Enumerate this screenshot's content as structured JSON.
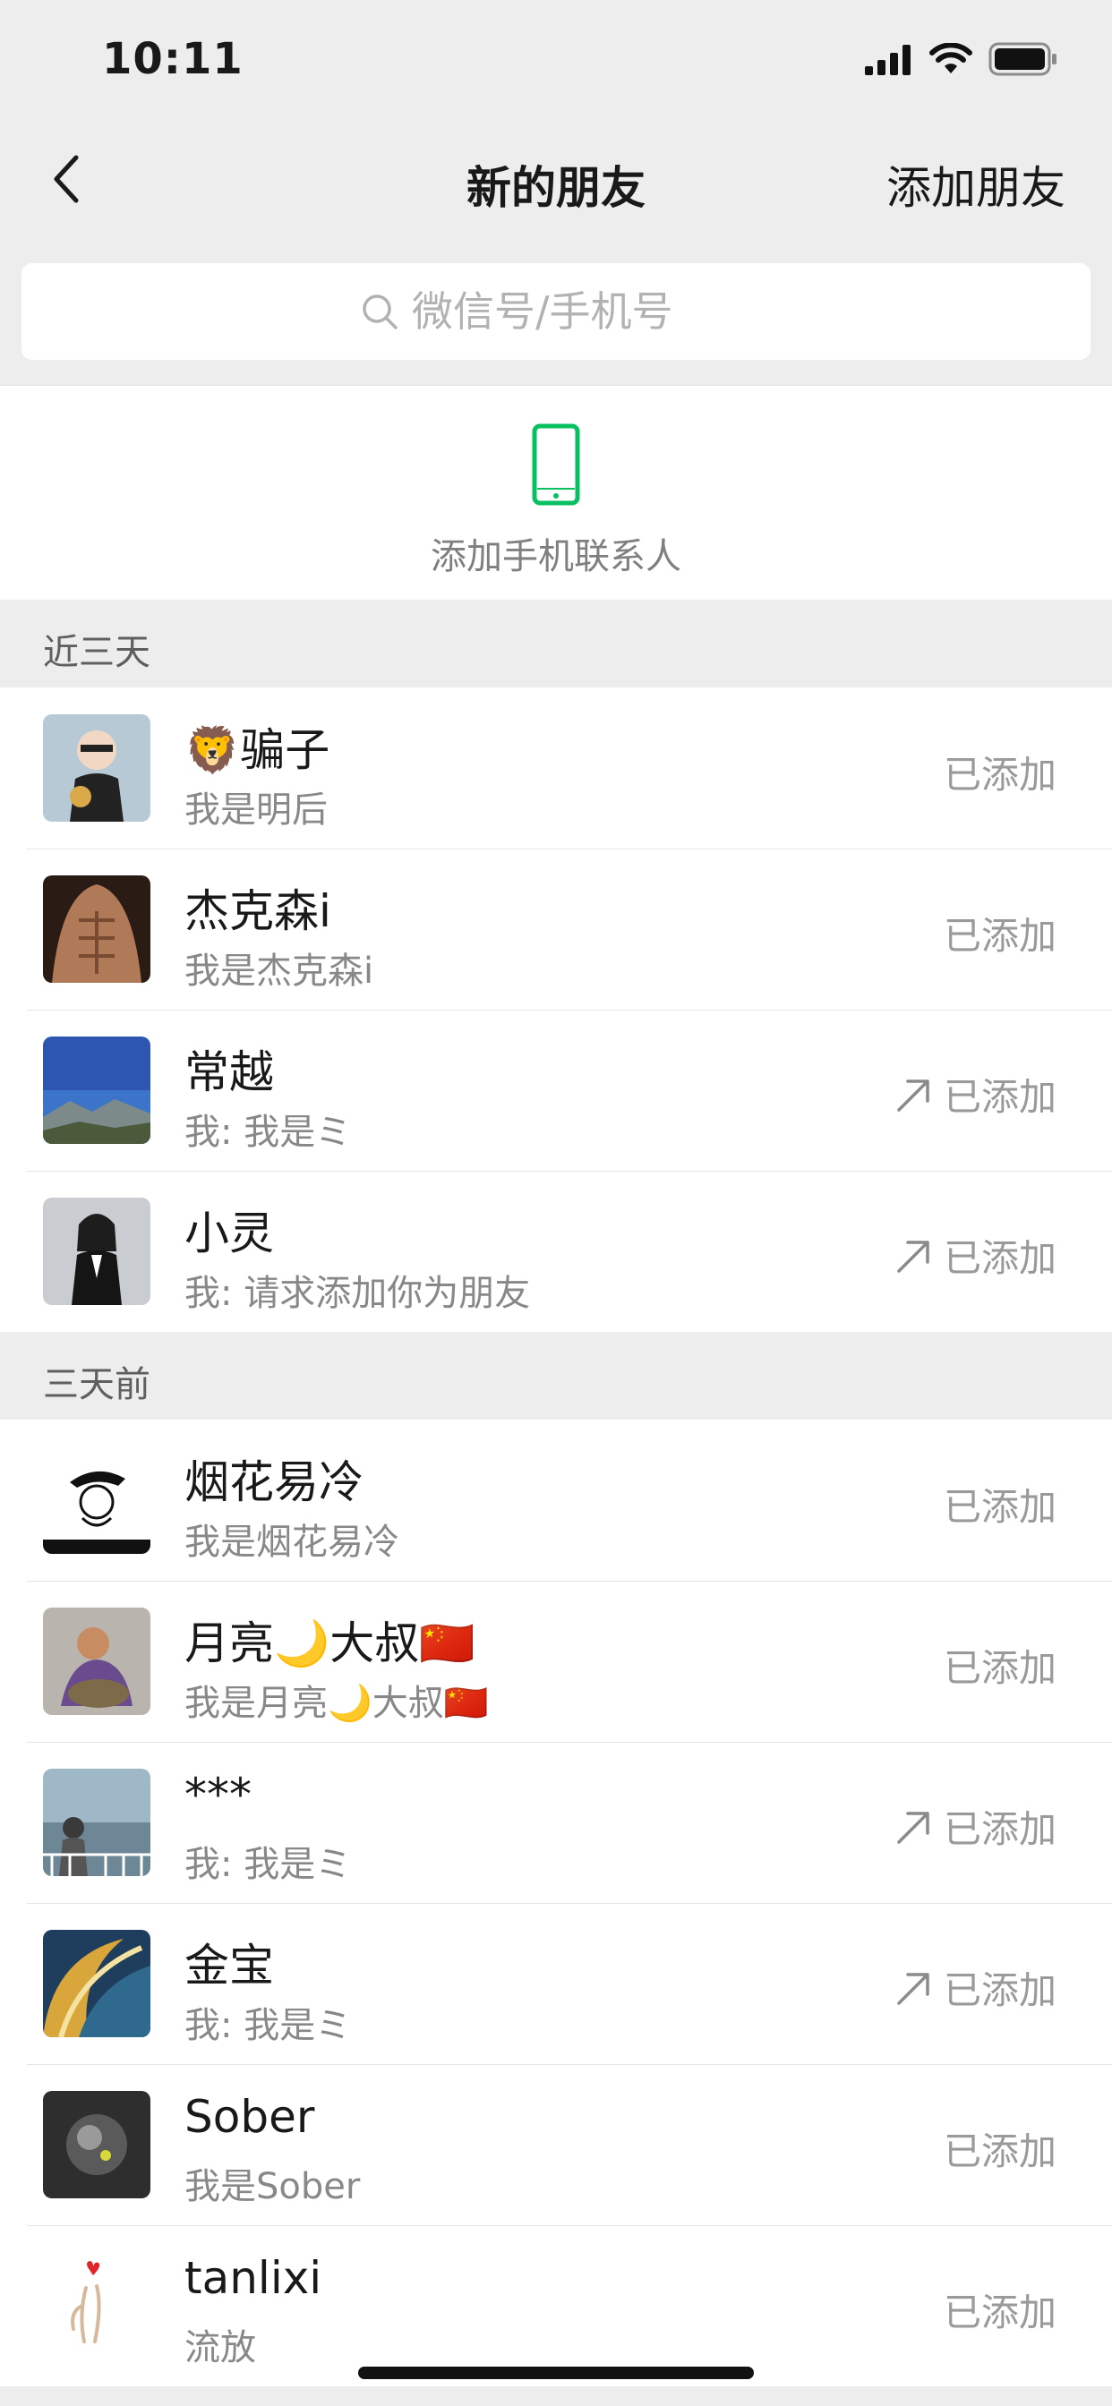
{
  "status_bar": {
    "time": "10:11"
  },
  "nav": {
    "title": "新的朋友",
    "action": "添加朋友"
  },
  "search": {
    "placeholder": "微信号/手机号"
  },
  "add_contacts": {
    "label": "添加手机联系人"
  },
  "sections": [
    {
      "title": "近三天",
      "rows": [
        {
          "name": "🦁骗子",
          "message": "我是明后",
          "status": "已添加",
          "outgoing": false
        },
        {
          "name": "杰克森i",
          "message": "我是杰克森i",
          "status": "已添加",
          "outgoing": false
        },
        {
          "name": "常越",
          "message": "我: 我是ミ",
          "status": "已添加",
          "outgoing": true
        },
        {
          "name": "小灵",
          "message": "我: 请求添加你为朋友",
          "status": "已添加",
          "outgoing": true
        }
      ]
    },
    {
      "title": "三天前",
      "rows": [
        {
          "name": "烟花易冷",
          "message": "我是烟花易冷",
          "status": "已添加",
          "outgoing": false
        },
        {
          "name": "月亮🌙大叔🇨🇳",
          "message": "我是月亮🌙大叔🇨🇳",
          "status": "已添加",
          "outgoing": false
        },
        {
          "name": "***",
          "message": "我: 我是ミ",
          "status": "已添加",
          "outgoing": true
        },
        {
          "name": "金宝",
          "message": "我: 我是ミ",
          "status": "已添加",
          "outgoing": true
        },
        {
          "name": "Sober",
          "message": "我是Sober",
          "status": "已添加",
          "outgoing": false
        },
        {
          "name": "tanlixi",
          "message": "流放",
          "status": "已添加",
          "outgoing": false
        }
      ]
    }
  ],
  "colors": {
    "background": "#ededed",
    "accent": "#07c160",
    "secondary_text": "#888888"
  }
}
